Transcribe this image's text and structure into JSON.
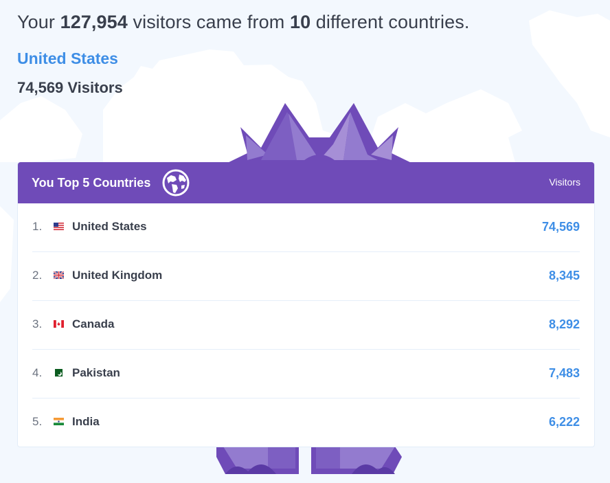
{
  "summary": {
    "prefix": "Your",
    "total_visitors": "127,954",
    "middle": "visitors came from",
    "country_count": "10",
    "suffix": "different countries."
  },
  "selected_country": {
    "name": "United States",
    "visitors_label": "74,569 Visitors"
  },
  "table": {
    "title": "You Top 5 Countries",
    "title_icon": "globe-icon",
    "column_header": "Visitors",
    "rows": [
      {
        "rank": "1.",
        "flag": "us-flag-icon",
        "country": "United States",
        "visitors": "74,569"
      },
      {
        "rank": "2.",
        "flag": "uk-flag-icon",
        "country": "United Kingdom",
        "visitors": "8,345"
      },
      {
        "rank": "3.",
        "flag": "canada-flag-icon",
        "country": "Canada",
        "visitors": "8,292"
      },
      {
        "rank": "4.",
        "flag": "pakistan-flag-icon",
        "country": "Pakistan",
        "visitors": "7,483"
      },
      {
        "rank": "5.",
        "flag": "india-flag-icon",
        "country": "India",
        "visitors": "6,222"
      }
    ]
  },
  "colors": {
    "accent_purple": "#6f4bb8",
    "link_blue": "#3e8ee6",
    "background": "#f3f8fe",
    "text_dark": "#393f4c"
  }
}
